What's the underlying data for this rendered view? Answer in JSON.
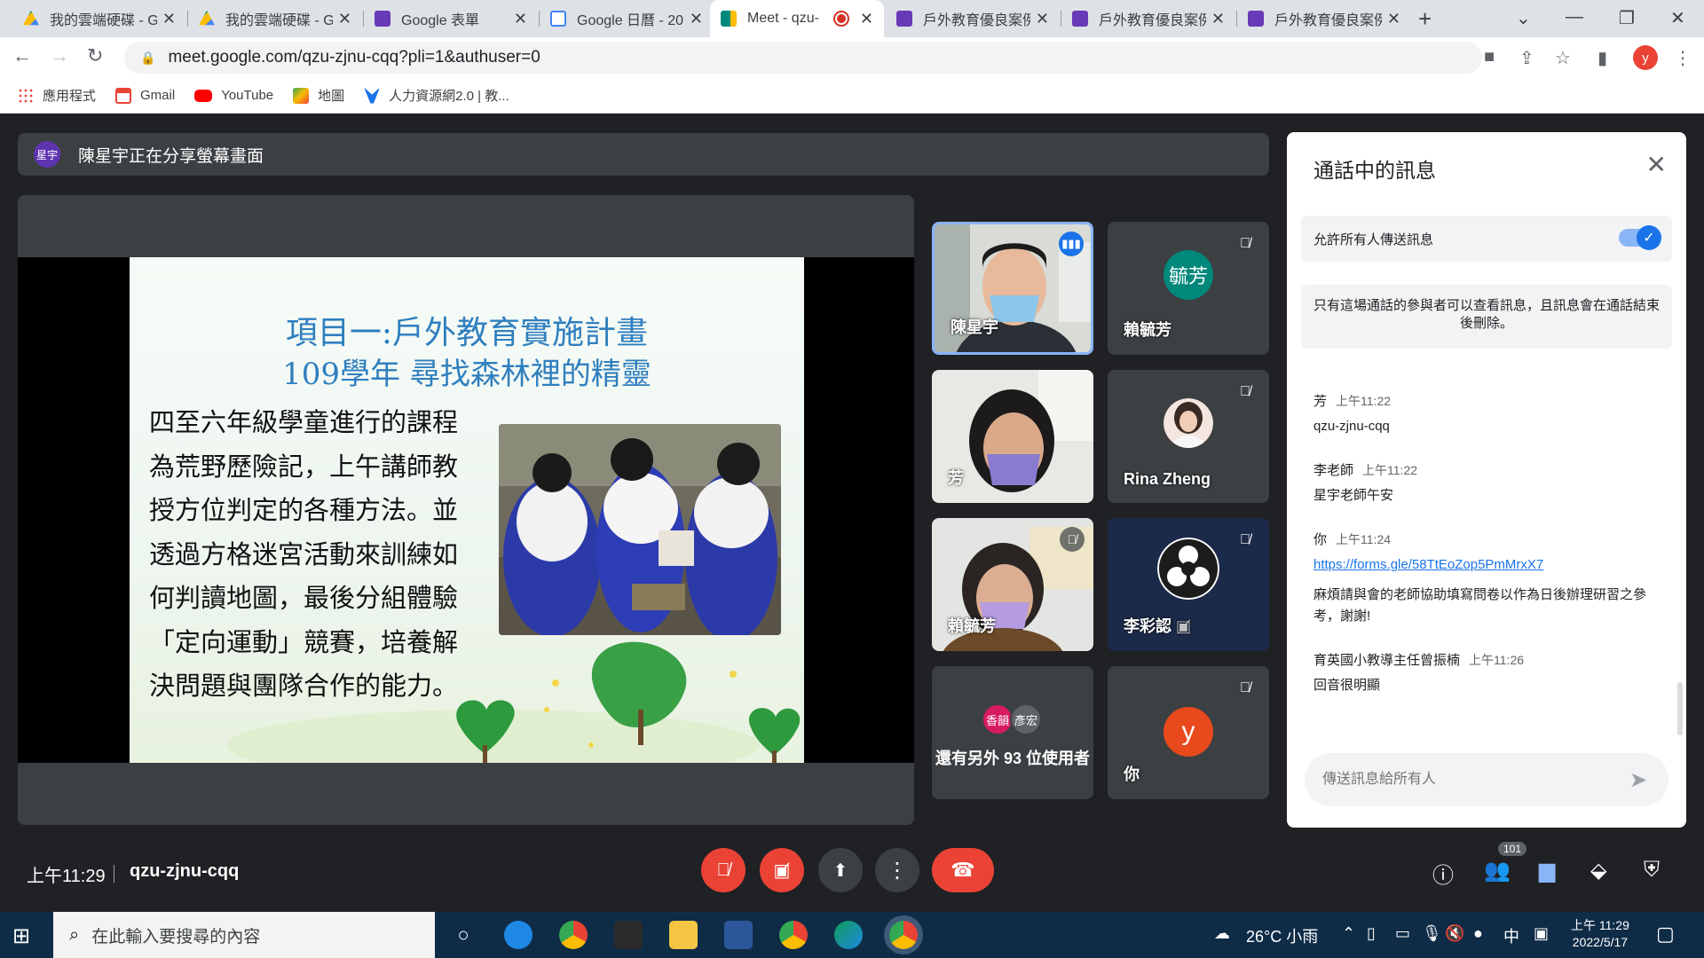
{
  "browser": {
    "tabs": [
      {
        "title": "我的雲端硬碟 - G",
        "icon_color": "#fbbc04",
        "active": false
      },
      {
        "title": "我的雲端硬碟 - G",
        "icon_color": "#fbbc04",
        "active": false
      },
      {
        "title": "Google 表單",
        "icon_color": "#673ab7",
        "active": false
      },
      {
        "title": "Google 日曆 - 20",
        "icon_color": "#4285f4",
        "active": false
      },
      {
        "title": "Meet - qzu-",
        "icon_color": "#00897b",
        "active": true
      },
      {
        "title": "戶外教育優良案例",
        "icon_color": "#673ab7",
        "active": false
      },
      {
        "title": "戶外教育優良案例",
        "icon_color": "#673ab7",
        "active": false
      },
      {
        "title": "戶外教育優良案例",
        "icon_color": "#673ab7",
        "active": false
      }
    ],
    "url": "meet.google.com/qzu-zjnu-cqq?pli=1&authuser=0",
    "profile_initial": "y",
    "bookmarks": [
      {
        "label": "應用程式",
        "icon_color": "#4285f4"
      },
      {
        "label": "Gmail",
        "icon_color": "#ea4335"
      },
      {
        "label": "YouTube",
        "icon_color": "#ff0000"
      },
      {
        "label": "地圖",
        "icon_color": "#34a853"
      },
      {
        "label": "人力資源網2.0 | 教...",
        "icon_color": "#1a73e8"
      }
    ]
  },
  "meet": {
    "presenter_badge": "星宇",
    "presenting_text": "陳星宇正在分享螢幕畫面",
    "slide": {
      "title_line1": "項目一:戶外教育實施計畫",
      "title_line2": "109學年 尋找森林裡的精靈",
      "body_lines": [
        "四至六年級學童進行的課程",
        "為荒野歷險記，上午講師教",
        "授方位判定的各種方法。並",
        "透過方格迷宮活動來訓練如",
        "何判讀地圖，最後分組體驗",
        "「定向運動」競賽，培養解",
        "決問題與團隊合作的能力。"
      ]
    },
    "tiles": [
      {
        "name": "陳星宇",
        "type": "video"
      },
      {
        "name": "賴毓芳",
        "type": "avatar",
        "avatar": "毓芳",
        "avatar_color": "#00897b"
      },
      {
        "name": "芳",
        "type": "video"
      },
      {
        "name": "Rina Zheng",
        "type": "photo"
      },
      {
        "name": "賴毓芳",
        "type": "video"
      },
      {
        "name": "李彩認",
        "type": "logo"
      },
      {
        "name": "還有另外 93 位使用者",
        "type": "others",
        "avatars": [
          "香韻",
          "彥宏"
        ]
      },
      {
        "name": "你",
        "type": "avatar",
        "avatar": "y",
        "avatar_color": "#e8491d"
      }
    ],
    "chat": {
      "title": "通話中的訊息",
      "allow_label": "允許所有人傳送訊息",
      "allow_on": true,
      "notice": "只有這場通話的參與者可以查看訊息，且訊息會在通話結束後刪除。",
      "messages": [
        {
          "sender": "芳",
          "time": "上午11:22",
          "text": "qzu-zjnu-cqq"
        },
        {
          "sender": "李老師",
          "time": "上午11:22",
          "text": "星宇老師午安"
        },
        {
          "sender": "你",
          "time": "上午11:24",
          "link": "https://forms.gle/58TtEoZop5PmMrxX7",
          "text": "麻煩請與會的老師協助填寫問卷以作為日後辦理研習之參考，謝謝!"
        },
        {
          "sender": "育英國小教導主任曾振楠",
          "time": "上午11:26",
          "text": "回音很明顯"
        }
      ],
      "input_placeholder": "傳送訊息給所有人"
    },
    "controls": {
      "time": "上午11:29",
      "meeting_code": "qzu-zjnu-cqq",
      "participants_count": "101",
      "colors": {
        "mute_red": "#ea4335",
        "neutral": "#3c4043",
        "chat_active": "#8ab4f8"
      }
    }
  },
  "taskbar": {
    "search_placeholder": "在此輸入要搜尋的內容",
    "weather": "26°C 小雨",
    "ime": "中",
    "clock_time": "上午 11:29",
    "clock_date": "2022/5/17"
  }
}
